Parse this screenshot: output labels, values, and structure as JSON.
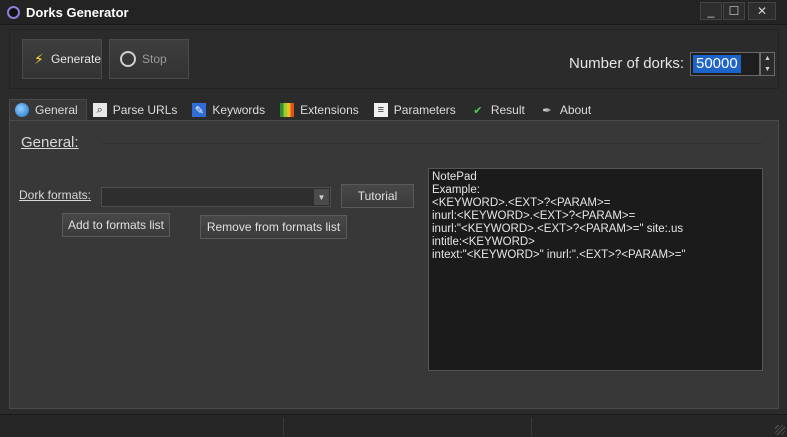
{
  "window": {
    "title": "Dorks Generator",
    "min": "_",
    "max": "☐",
    "close": "✕"
  },
  "toolbar": {
    "generate_label": "Generate",
    "stop_label": "Stop",
    "number_label": "Number of dorks:",
    "number_value": "50000"
  },
  "tabs": [
    {
      "label": "General",
      "icon": "globe-icon",
      "active": true
    },
    {
      "label": "Parse URLs",
      "icon": "parse-urls-icon"
    },
    {
      "label": "Keywords",
      "icon": "keywords-icon"
    },
    {
      "label": "Extensions",
      "icon": "extensions-icon"
    },
    {
      "label": "Parameters",
      "icon": "parameters-icon"
    },
    {
      "label": "Result",
      "icon": "check-icon"
    },
    {
      "label": "About",
      "icon": "about-icon"
    }
  ],
  "general": {
    "title": "General:",
    "dork_formats_label": "Dork formats:",
    "dork_formats_value": "",
    "tutorial_label": "Tutorial",
    "add_label": "Add to formats list",
    "remove_label": "Remove from formats list",
    "notepad_text": "NotePad\nExample:\n<KEYWORD>.<EXT>?<PARAM>=\ninurl:<KEYWORD>.<EXT>?<PARAM>=\ninurl:\"<KEYWORD>.<EXT>?<PARAM>=\" site:.us\nintitle:<KEYWORD>\nintext:\"<KEYWORD>\" inurl:\".<EXT>?<PARAM>=\""
  },
  "colors": {
    "background": "#2b2b2b",
    "panel": "#383838",
    "selection": "#1e64c8",
    "text": "#d8d8d8"
  }
}
